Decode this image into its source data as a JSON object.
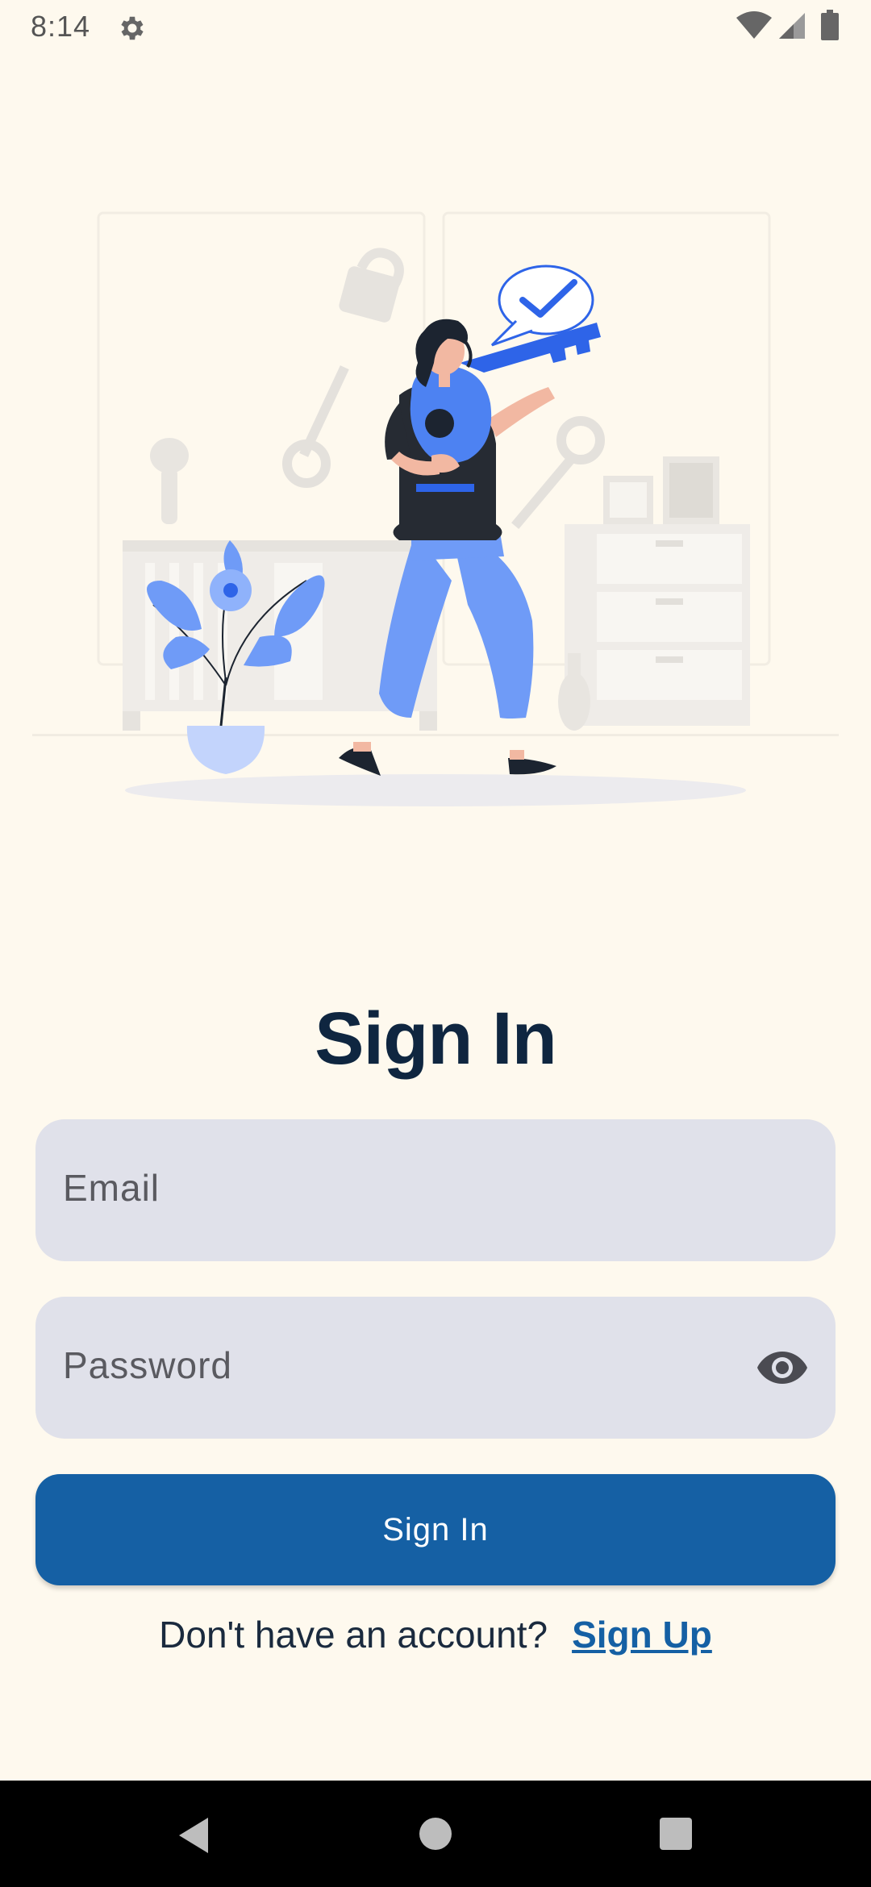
{
  "status_bar": {
    "time": "8:14",
    "icons": [
      "gear-icon",
      "wifi-icon",
      "signal-icon",
      "battery-icon"
    ]
  },
  "illustration": {
    "name": "person-holding-key-illustration"
  },
  "signin": {
    "title": "Sign In",
    "email_placeholder": "Email",
    "password_placeholder": "Password",
    "button_label": "Sign In",
    "footer_prompt": "Don't have an account?",
    "footer_link": "Sign Up"
  },
  "nav_bar": {
    "icons": [
      "back-icon",
      "home-icon",
      "recents-icon"
    ]
  },
  "colors": {
    "background": "#fef9ee",
    "title": "#0f2640",
    "field": "#e0e1ea",
    "primary": "#1560a4",
    "illustration_blue": "#6f9bf7"
  }
}
